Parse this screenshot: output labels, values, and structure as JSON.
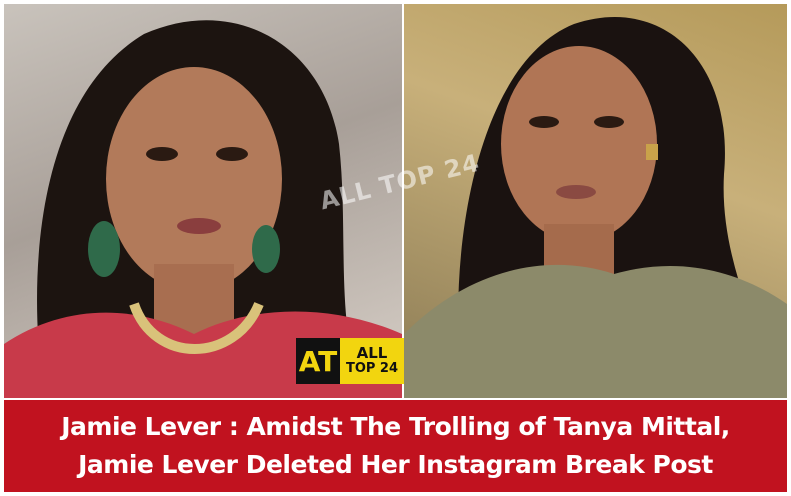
{
  "watermark": {
    "text": "ALL TOP 24"
  },
  "logo": {
    "mark": "AT",
    "line1": "ALL",
    "line2": "TOP 24"
  },
  "caption": {
    "line1": "Jamie Lever : Amidst The Trolling of Tanya Mittal,",
    "line2": "Jamie Lever Deleted Her Instagram Break Post"
  },
  "colors": {
    "caption_bg": "#c1121f",
    "caption_text": "#ffffff",
    "logo_yellow": "#f2d50f",
    "logo_dark": "#111111"
  }
}
